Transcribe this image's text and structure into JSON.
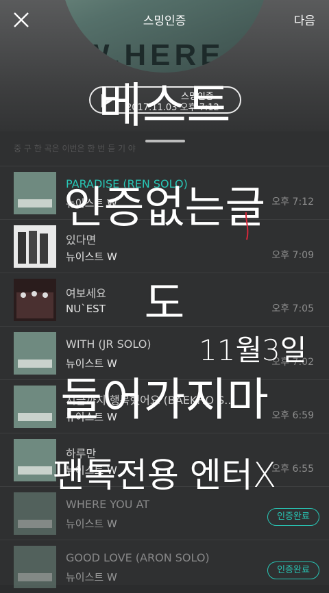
{
  "header": {
    "title": "스밍인증",
    "next_label": "다음",
    "album_word": "W.HERE",
    "pill_label": "스밍인증",
    "pill_date": "2017.11.03 오후 7:12"
  },
  "sheet": {
    "note": "중 구 한 곡은 이번은 한 번 듣 기 야"
  },
  "songs": [
    {
      "title": "PARADISE (REN SOLO)",
      "artist": "뉴이스트 W",
      "time": "오후 7:12",
      "active": true
    },
    {
      "title": "있다면",
      "artist": "뉴이스트 W",
      "time": "오후 7:09"
    },
    {
      "title": "여보세요",
      "artist": "NU`EST",
      "time": "오후 7:05"
    },
    {
      "title": "WITH (JR SOLO)",
      "artist": "뉴이스트 W",
      "time": "오후 7:02"
    },
    {
      "title": "지금까지 행복했어요 (BAEKHO S...",
      "artist": "뉴이스트 W",
      "time": "오후 6:59"
    },
    {
      "title": "하루만",
      "artist": "뉴이스트 W",
      "time": "오후 6:55"
    },
    {
      "title": "WHERE YOU AT",
      "artist": "뉴이스트 W",
      "badge": "인증완료"
    },
    {
      "title": "GOOD LOVE (ARON SOLO)",
      "artist": "뉴이스트 W",
      "badge": "인증완료"
    }
  ],
  "overlay": {
    "line1": "베스트",
    "line2": "인증없는글",
    "line3": "도",
    "line4": "11월3일",
    "line5": "들어가지마",
    "line6": "팬톡전용 엔터X"
  },
  "colors": {
    "accent": "#28c7b6",
    "background": "#2f3031"
  }
}
